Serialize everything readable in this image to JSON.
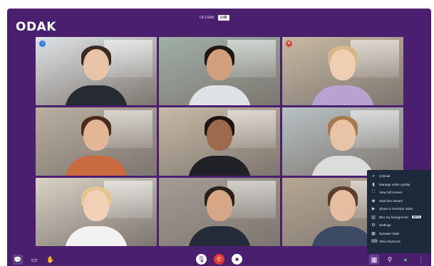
{
  "app": {
    "brand": "ODAK",
    "title": "OLCSAN",
    "time": "1:40"
  },
  "participants": [
    {
      "id": 1,
      "badge": "mic",
      "bg": "#dfe3e6",
      "skin": "#e8c3a5",
      "hair": "#3b2a20",
      "shirt": "#262a31"
    },
    {
      "id": 2,
      "badge": "",
      "bg": "#9fb0a8",
      "skin": "#d3a07d",
      "hair": "#1f1713",
      "shirt": "#dfe3e8"
    },
    {
      "id": 3,
      "badge": "rec",
      "bg": "#c8b9a3",
      "skin": "#efcfb4",
      "hair": "#d7b58a",
      "shirt": "#b8a2cf"
    },
    {
      "id": 4,
      "badge": "",
      "bg": "#b9aea0",
      "skin": "#e3b796",
      "hair": "#4a2a1b",
      "shirt": "#c96a3f"
    },
    {
      "id": 5,
      "badge": "",
      "bg": "#c7b9a6",
      "skin": "#9c6a4c",
      "hair": "#1e1510",
      "shirt": "#202126"
    },
    {
      "id": 6,
      "badge": "",
      "bg": "#b8c1c4",
      "skin": "#e9c3a6",
      "hair": "#a57a4e",
      "shirt": "#dcdcdc"
    },
    {
      "id": 7,
      "badge": "",
      "bg": "#d8d2c6",
      "skin": "#f1d0b6",
      "hair": "#e2c58f",
      "shirt": "#f2f2f2"
    },
    {
      "id": 8,
      "badge": "",
      "bg": "#a49d94",
      "skin": "#d6a786",
      "hair": "#2a1f19",
      "shirt": "#242c3a"
    },
    {
      "id": 9,
      "badge": "",
      "bg": "#b7a794",
      "skin": "#e6bd9e",
      "hair": "#5a3d2a",
      "shirt": "#3c4a63"
    }
  ],
  "menu": {
    "items": [
      {
        "icon": "circle-icon",
        "glyph": "●",
        "label": "Çıkmak",
        "green": true
      },
      {
        "icon": "signal-icon",
        "glyph": "▮",
        "label": "Manage video quality"
      },
      {
        "icon": "fullscreen-icon",
        "glyph": "⛶",
        "label": "View full screen"
      },
      {
        "icon": "live-icon",
        "glyph": "◉",
        "label": "Start live stream"
      },
      {
        "icon": "youtube-icon",
        "glyph": "▶",
        "label": "Share a YouTube video"
      },
      {
        "icon": "blur-icon",
        "glyph": "▥",
        "label": "Blur my background",
        "beta": "BETA"
      },
      {
        "icon": "gear-icon",
        "glyph": "⚙",
        "label": "Settings"
      },
      {
        "icon": "speaker-stats-icon",
        "glyph": "▦",
        "label": "Speaker stats"
      },
      {
        "icon": "shortcuts-icon",
        "glyph": "⌨",
        "label": "View shortcuts"
      }
    ]
  },
  "toolbar": {
    "chat": "💬",
    "screen": "▭",
    "hand": "✋",
    "mic": "🎙",
    "hangup": "✆",
    "camera": "■",
    "tile_view": "▦",
    "invite": "⚲",
    "security": "●",
    "more": "⋮"
  },
  "colors": {
    "accent": "#4a1f6e",
    "menu_bg": "#1d2a3c",
    "hangup": "#e53a31"
  }
}
